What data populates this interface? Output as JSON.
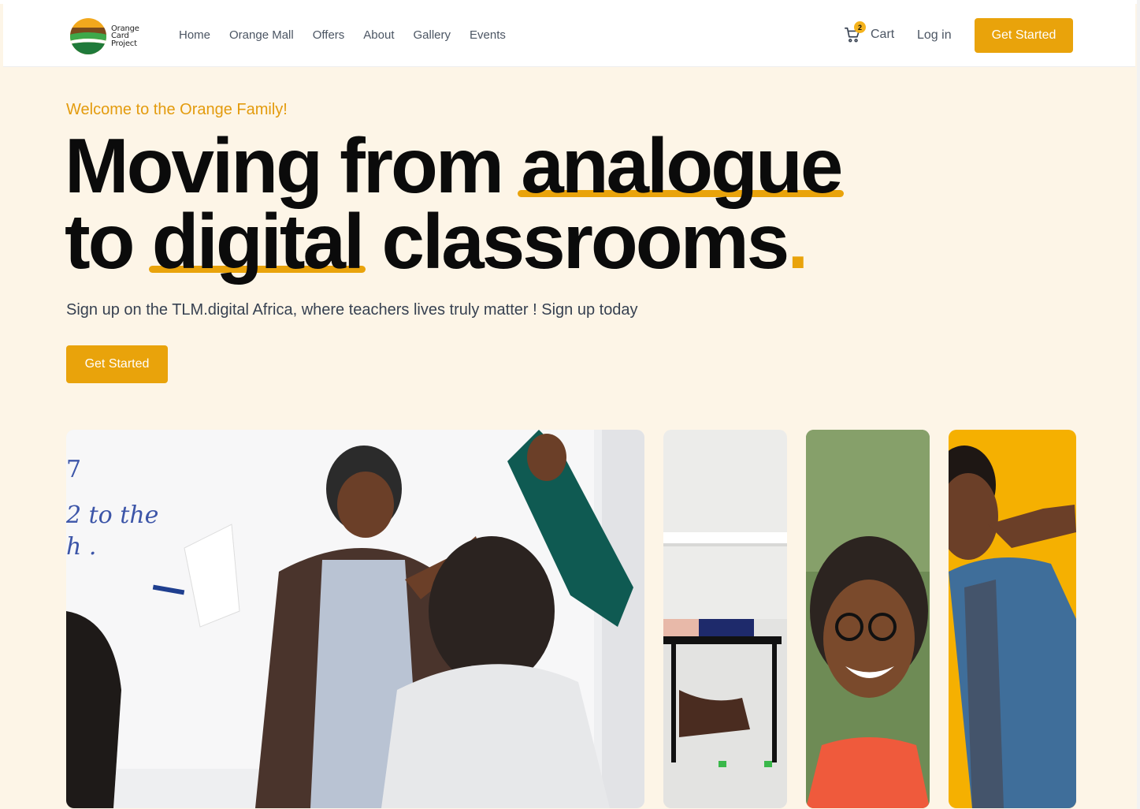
{
  "brand": {
    "logo_lines": [
      "Orange",
      "Card",
      "Project"
    ],
    "accent_color": "#e9a30b"
  },
  "nav": {
    "links": [
      "Home",
      "Orange Mall",
      "Offers",
      "About",
      "Gallery",
      "Events"
    ],
    "cart_label": "Cart",
    "cart_count": "2",
    "login_label": "Log in",
    "cta_label": "Get Started"
  },
  "hero": {
    "welcome": "Welcome to the Orange Family!",
    "headline": {
      "line1_plain": "Moving from ",
      "line1_highlight": "analogue",
      "line2_plain_start": "to ",
      "line2_highlight": "digital",
      "line2_plain_end": " classrooms",
      "dot": "."
    },
    "subtext": "Sign up on the TLM.digital Africa, where teachers lives truly matter ! Sign up today",
    "cta_label": "Get Started"
  },
  "gallery": {
    "photos": [
      {
        "name": "teacher-classroom-photo",
        "whiteboard_text": "2 to the"
      },
      {
        "name": "classroom-desk-photo"
      },
      {
        "name": "smiling-woman-glasses-photo"
      },
      {
        "name": "man-denim-jacket-photo"
      }
    ]
  }
}
